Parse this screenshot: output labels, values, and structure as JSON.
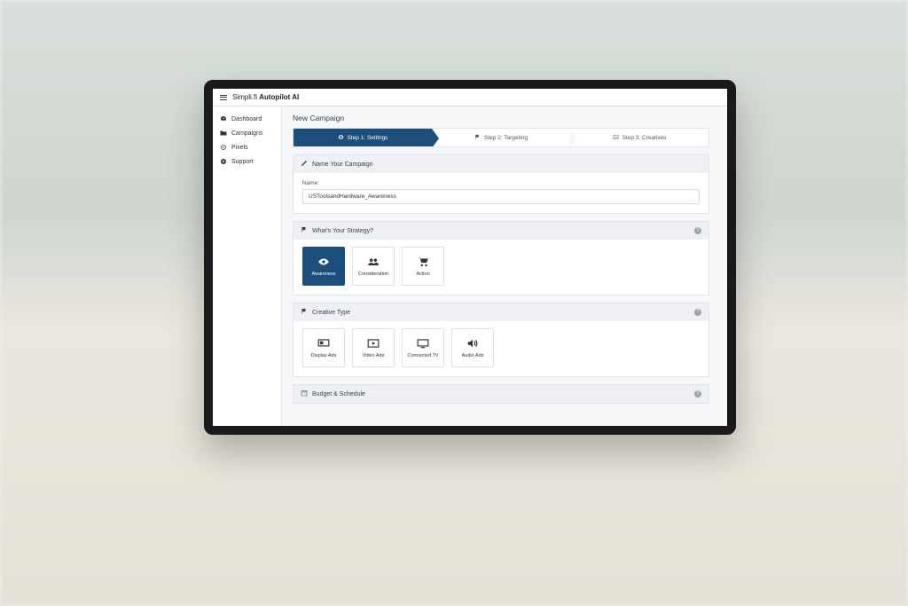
{
  "brand": {
    "name": "Simpli.fi",
    "product": "Autopilot AI"
  },
  "sidebar": {
    "items": [
      {
        "label": "Dashboard",
        "icon": "gauge"
      },
      {
        "label": "Campaigns",
        "icon": "folder"
      },
      {
        "label": "Pixels",
        "icon": "crosshair"
      },
      {
        "label": "Support",
        "icon": "plus"
      }
    ]
  },
  "page": {
    "title": "New Campaign"
  },
  "steps": [
    {
      "label": "Step 1: Settings",
      "icon": "gear",
      "active": true
    },
    {
      "label": "Step 2: Targeting",
      "icon": "flag",
      "active": false
    },
    {
      "label": "Step 3: Creatives",
      "icon": "image",
      "active": false
    }
  ],
  "panels": {
    "name": {
      "title": "Name Your Campaign",
      "icon": "pencil",
      "field_label": "Name:",
      "value": "USToolsandHardware_Awareness"
    },
    "strategy": {
      "title": "What's Your Strategy?",
      "icon": "flag",
      "options": [
        {
          "label": "Awareness",
          "icon": "eye",
          "selected": true
        },
        {
          "label": "Consideration",
          "icon": "people",
          "selected": false
        },
        {
          "label": "Action",
          "icon": "cart",
          "selected": false
        }
      ]
    },
    "creative": {
      "title": "Creative Type",
      "icon": "flag",
      "options": [
        {
          "label": "Display Ads",
          "icon": "display"
        },
        {
          "label": "Video Ads",
          "icon": "video"
        },
        {
          "label": "Connected TV",
          "icon": "tv"
        },
        {
          "label": "Audio Ads",
          "icon": "audio"
        }
      ]
    },
    "budget": {
      "title": "Budget & Schedule",
      "icon": "calendar"
    }
  }
}
